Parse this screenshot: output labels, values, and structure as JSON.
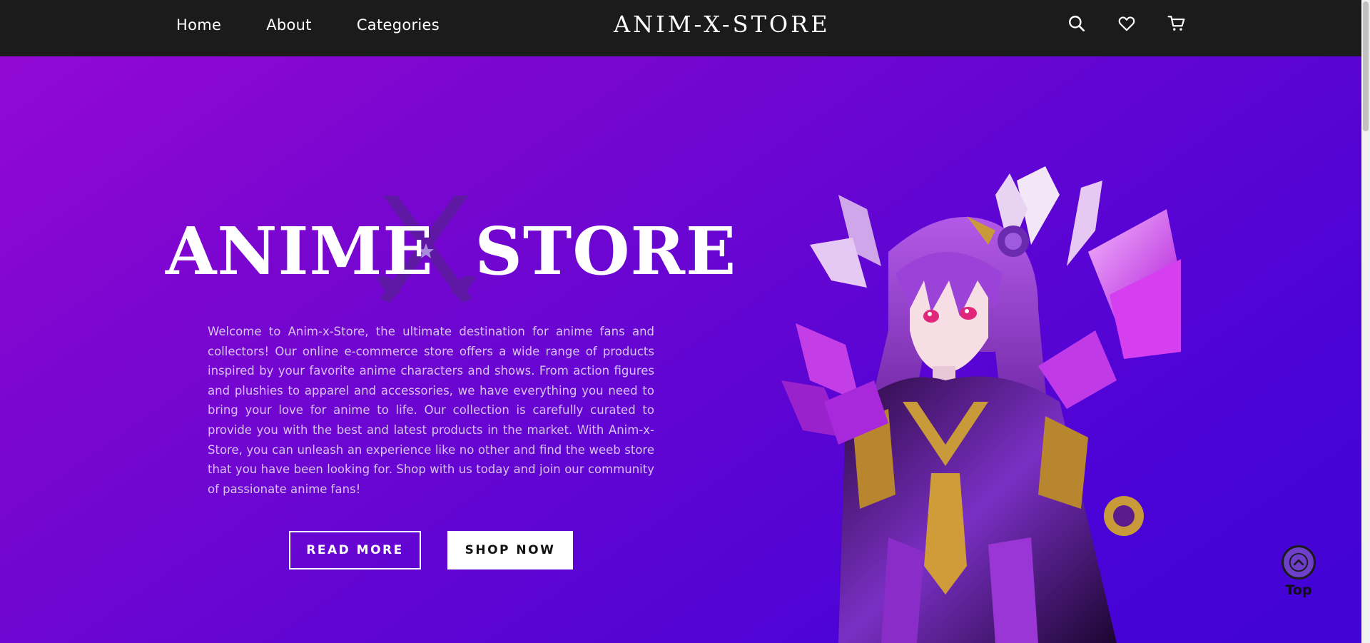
{
  "nav": {
    "links": [
      "Home",
      "About",
      "Categories"
    ],
    "brand": "ANIM-X-STORE",
    "icons": [
      "search-icon",
      "heart-icon",
      "cart-icon"
    ]
  },
  "hero": {
    "title_left": "ANIME",
    "title_right": "STORE",
    "description": "Welcome to Anim-x-Store, the ultimate destination for anime fans and collectors! Our online e-commerce store offers a wide range of products inspired by your favorite anime characters and shows. From action figures and plushies to apparel and accessories, we have everything you need to bring your love for anime to life. Our collection is carefully curated to provide you with the best and latest products in the market. With Anim-x-Store, you can unleash an experience like no other and find the weeb store that you have been looking for. Shop with us today and join our community of passionate anime fans!",
    "read_more_label": "READ MORE",
    "shop_now_label": "SHOP NOW"
  },
  "top_button": {
    "label": "Top"
  },
  "colors": {
    "navbar": "#1b1b1b",
    "hero_gradient_start": "#9309d4",
    "hero_gradient_end": "#4203d6",
    "description_text": "#d7c2f3",
    "accent_purple": "#6e3fc9"
  }
}
